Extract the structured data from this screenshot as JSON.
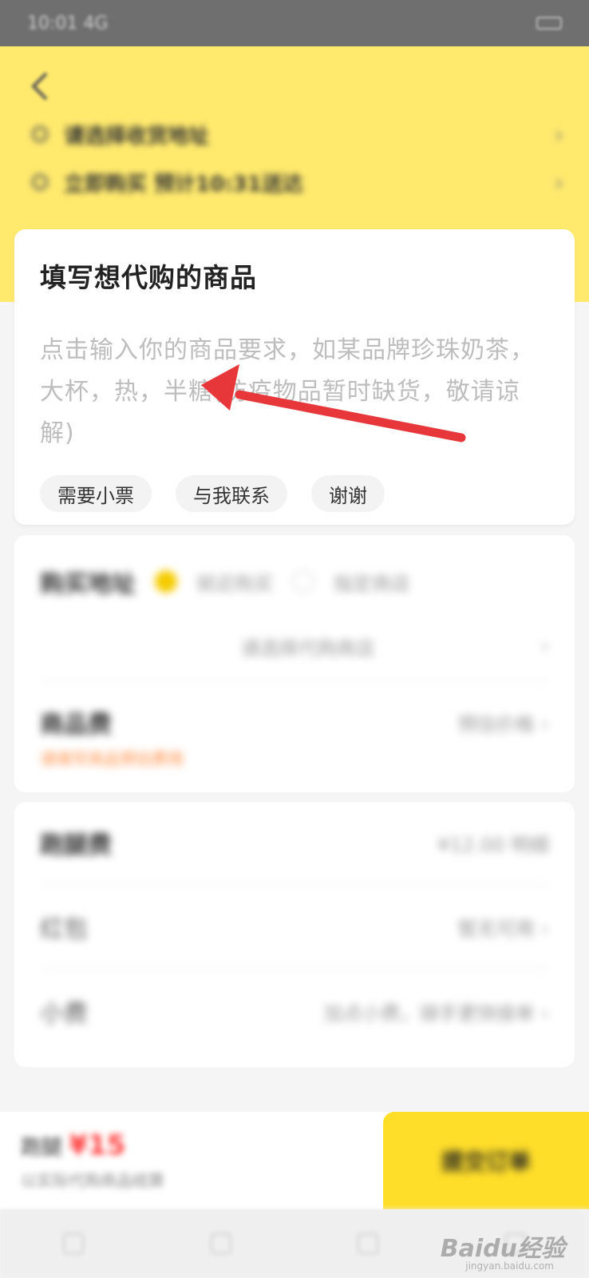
{
  "status_bar": {
    "time": "10:01 4G"
  },
  "header": {
    "address_rows": [
      {
        "text": "请选择收货地址"
      },
      {
        "text": "立即购买 预计10:31送达"
      }
    ]
  },
  "product_card": {
    "title": "填写想代购的商品",
    "placeholder": "点击输入你的商品要求，如某品牌珍珠奶茶，大杯，热，半糖(防疫物品暂时缺货，敬请谅解)",
    "tags": [
      "需要小票",
      "与我联系",
      "谢谢"
    ]
  },
  "purchase_card": {
    "title": "购买地址",
    "options": [
      "就近购买",
      "指定商店"
    ],
    "address_hint": "请选择代购商店",
    "goods_label": "商品费",
    "goods_value": "预估价格",
    "note": "请填写商品预估费用"
  },
  "fee_card": {
    "rows": [
      {
        "label": "跑腿费",
        "value": "¥12.00 明细"
      },
      {
        "label": "红包",
        "value": "暂无可用"
      },
      {
        "label": "小费",
        "value": "加点小费，骑手更快接单"
      }
    ]
  },
  "bottom_bar": {
    "price_prefix": "跑腿",
    "price": "¥15",
    "sub": "以实际代购商品结算",
    "submit_label": "提交订单"
  },
  "watermark": {
    "brand": "Baidu经验",
    "sub": "jingyan.baidu.com"
  },
  "colors": {
    "header_yellow": "#ffea6e",
    "button_yellow": "#ffde2a",
    "arrow_red": "#e8373a",
    "accent_orange": "#ff8a3d"
  }
}
